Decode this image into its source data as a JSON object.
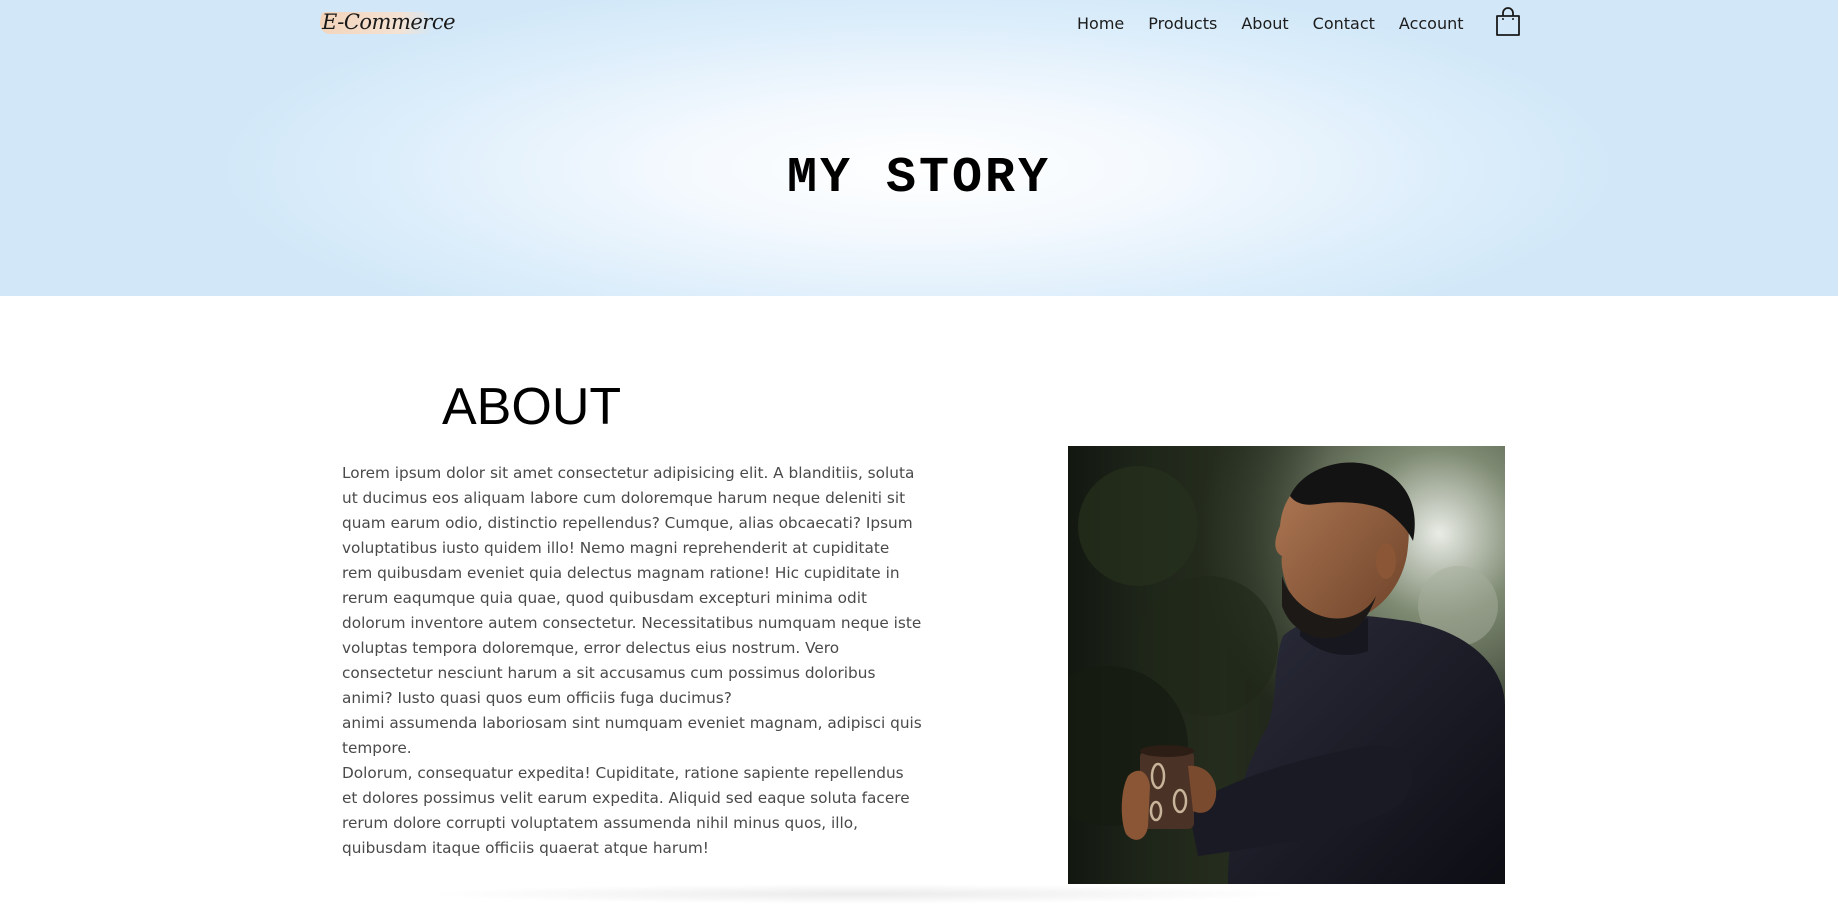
{
  "brand": {
    "logo_text": "E-Commerce"
  },
  "nav": {
    "items": [
      {
        "label": "Home"
      },
      {
        "label": "Products"
      },
      {
        "label": "About"
      },
      {
        "label": "Contact"
      },
      {
        "label": "Account"
      }
    ],
    "cart_icon": "shopping-bag-icon"
  },
  "hero": {
    "title": "MY STORY"
  },
  "about": {
    "heading": "ABOUT",
    "paragraphs": [
      "Lorem ipsum dolor sit amet consectetur adipisicing elit. A blanditiis, soluta ut ducimus eos aliquam labore cum doloremque harum neque deleniti sit quam earum odio, distinctio repellendus? Cumque, alias obcaecati? Ipsum voluptatibus iusto quidem illo! Nemo magni reprehenderit at cupiditate rem quibusdam eveniet quia delectus magnam ratione! Hic cupiditate in rerum eaqumque quia quae, quod quibusdam excepturi minima odit dolorum inventore autem consectetur. Necessitatibus numquam neque iste voluptas tempora doloremque, error delectus eius nostrum. Vero consectetur nesciunt harum a sit accusamus cum possimus doloribus animi? Iusto quasi quos eum officiis fuga ducimus?",
      "animi assumenda laboriosam sint numquam eveniet magnam, adipisci quis tempore.",
      "Dolorum, consequatur expedita! Cupiditate, ratione sapiente repellendus et dolores possimus velit earum expedita. Aliquid sed eaque soluta facere rerum dolore corrupti voluptatem assumenda nihil minus quos, illo, quibusdam itaque officiis quaerat atque harum!"
    ]
  },
  "colors": {
    "hero_bg": "#d2e8f8",
    "logo_swash": "#f6d2b4",
    "body_text": "#4a4a4a"
  }
}
